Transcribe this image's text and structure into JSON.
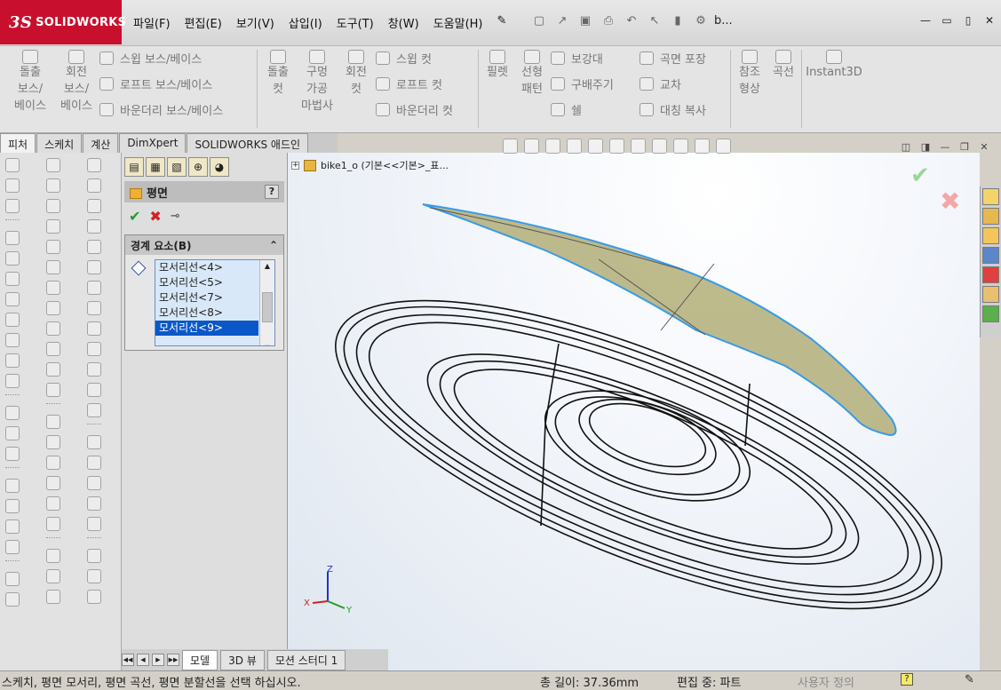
{
  "app": {
    "logo_text": "SOLIDWORKS",
    "logo_ds": "3S",
    "doc_title": "b..."
  },
  "menu": [
    "파일(F)",
    "편집(E)",
    "보기(V)",
    "삽입(I)",
    "도구(T)",
    "창(W)",
    "도움말(H)"
  ],
  "ribbon": {
    "extrude_boss": "돌출\n보스/\n베이스",
    "revolve_boss": "회전\n보스/\n베이스",
    "sweep_boss": "스윕 보스/베이스",
    "loft_boss": "로프트 보스/베이스",
    "boundary_boss": "바운더리 보스/베이스",
    "extrude_cut": "돌출\n컷",
    "hole_wizard": "구멍\n가공\n마법사",
    "revolve_cut": "회전\n컷",
    "sweep_cut": "스윕 컷",
    "loft_cut": "로프트 컷",
    "boundary_cut": "바운더리 컷",
    "fillet": "필렛",
    "linear_pattern": "선형\n패턴",
    "rib": "보강대",
    "draft": "구배주기",
    "shell": "쉘",
    "wrap": "곡면 포장",
    "intersect": "교차",
    "mirror": "대칭 복사",
    "reference_geometry": "참조\n형상",
    "curves": "곡선",
    "instant3d": "Instant3D"
  },
  "tabs": [
    "피처",
    "스케치",
    "계산",
    "DimXpert",
    "SOLIDWORKS 애드인"
  ],
  "property_manager": {
    "title": "평면",
    "help": "?",
    "group_title": "경계 요소(B)",
    "items": [
      "모서리선<4>",
      "모서리선<5>",
      "모서리선<7>",
      "모서리선<8>",
      "모서리선<9>"
    ],
    "selected_index": 4
  },
  "tree": {
    "root": "bike1_o  (기본<<기본>_표..."
  },
  "triad": {
    "x": "X",
    "y": "Y",
    "z": "Z"
  },
  "bottom_tabs": [
    "모델",
    "3D 뷰",
    "모션 스터디 1"
  ],
  "status": {
    "message": "스케치, 평면 모서리, 평면 곡선, 평면 분할선을 선택 하십시오.",
    "length": "총 길이: 37.36mm",
    "mode": "편집 중: 파트",
    "custom": "사용자 정의"
  }
}
